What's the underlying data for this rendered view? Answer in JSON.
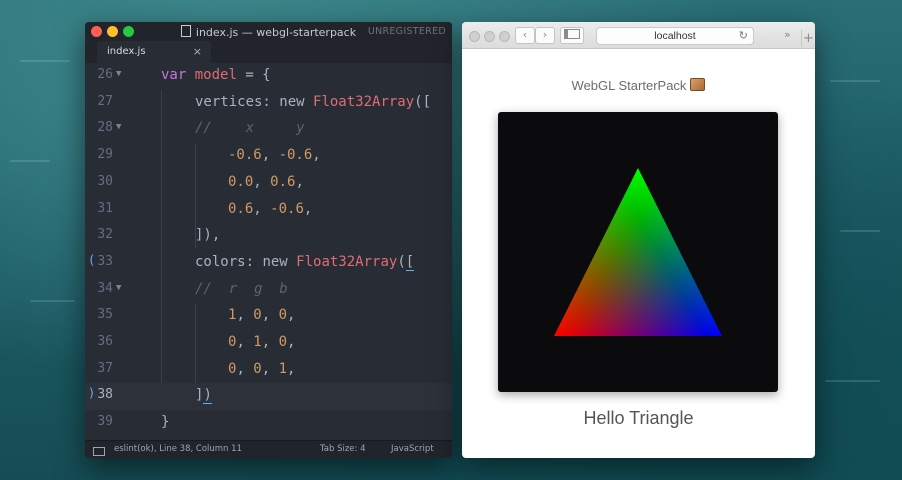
{
  "editor": {
    "title": "index.js — webgl-starterpack",
    "unregistered": "UNREGISTERED",
    "tab_label": "index.js",
    "tab_close": "×",
    "lines": [
      {
        "num": "26",
        "fold": true
      },
      {
        "num": "27"
      },
      {
        "num": "28",
        "fold": true
      },
      {
        "num": "29"
      },
      {
        "num": "30"
      },
      {
        "num": "31"
      },
      {
        "num": "32"
      },
      {
        "num": "33",
        "marker": "("
      },
      {
        "num": "34",
        "fold": true
      },
      {
        "num": "35"
      },
      {
        "num": "36"
      },
      {
        "num": "37"
      },
      {
        "num": "38",
        "marker": ")",
        "active": true
      },
      {
        "num": "39"
      }
    ],
    "code": {
      "l26_kw": "var",
      "l26_name": "model",
      "l26_rest": " = {",
      "l27_key": "vertices: ",
      "l27_new": "new ",
      "l27_cls": "Float32Array",
      "l27_rest": "([",
      "l28_cm": "//    x     y",
      "l29_a": "-0.6",
      "l29_sep": ", ",
      "l29_b": "-0.6",
      "l29_end": ",",
      "l30_a": "0.0",
      "l30_sep": ", ",
      "l30_b": "0.6",
      "l30_end": ",",
      "l31_a": "0.6",
      "l31_sep": ", ",
      "l31_b": "-0.6",
      "l31_end": ",",
      "l32": "]),",
      "l33_key": "colors: ",
      "l33_new": "new ",
      "l33_cls": "Float32Array",
      "l33_p": "(",
      "l33_b": "[",
      "l34_cm": "//  r  g  b",
      "l35_a": "1",
      "l35_s1": ", ",
      "l35_b": "0",
      "l35_s2": ", ",
      "l35_c": "0",
      "l35_end": ",",
      "l36_a": "0",
      "l36_s1": ", ",
      "l36_b": "1",
      "l36_s2": ", ",
      "l36_c": "0",
      "l36_end": ",",
      "l37_a": "0",
      "l37_s1": ", ",
      "l37_b": "0",
      "l37_s2": ", ",
      "l37_c": "1",
      "l37_end": ",",
      "l38_b": "]",
      "l38_p": ")",
      "l39": "}"
    },
    "status": {
      "lint": "eslint(ok), Line 38, Column 11",
      "tab_size": "Tab Size: 4",
      "language": "JavaScript"
    }
  },
  "browser": {
    "back": "‹",
    "forward": "›",
    "address": "localhost",
    "reload": "↻",
    "more": "»",
    "new_tab": "+",
    "page_title": "WebGL StarterPack",
    "caption": "Hello Triangle",
    "triangle": {
      "vertices": [
        [
          -0.6,
          -0.6
        ],
        [
          0.0,
          0.6
        ],
        [
          0.6,
          -0.6
        ]
      ],
      "colors": [
        "#ff0000",
        "#00ff00",
        "#0000ff"
      ]
    }
  },
  "colors": {
    "traffic_red": "#ff5f57",
    "traffic_yellow": "#febc2e",
    "traffic_green": "#28c840",
    "editor_bg": "#282c34",
    "canvas_bg": "#0b0a0c"
  }
}
